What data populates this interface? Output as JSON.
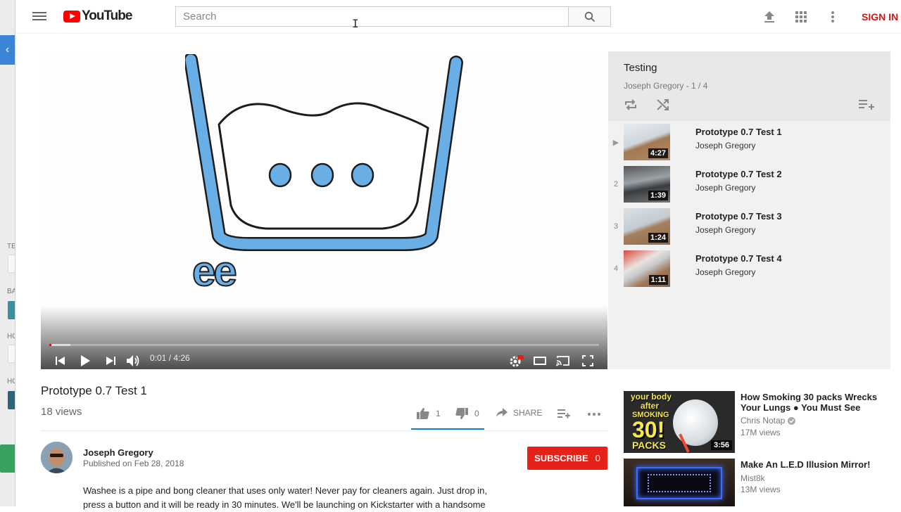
{
  "header": {
    "logo_text": "YouTube",
    "search_placeholder": "Search",
    "signin_label": "SIGN IN"
  },
  "player": {
    "time": "0:01 / 4:26",
    "progress_fraction": 0.004,
    "overlay_text": "ee"
  },
  "playlist": {
    "title": "Testing",
    "subtitle": "Joseph Gregory - 1 / 4",
    "items": [
      {
        "index": "▶",
        "title": "Prototype 0.7 Test 1",
        "channel": "Joseph Gregory",
        "duration": "4:27"
      },
      {
        "index": "2",
        "title": "Prototype 0.7 Test 2",
        "channel": "Joseph Gregory",
        "duration": "1:39"
      },
      {
        "index": "3",
        "title": "Prototype 0.7 Test 3",
        "channel": "Joseph Gregory",
        "duration": "1:24"
      },
      {
        "index": "4",
        "title": "Prototype 0.7 Test 4",
        "channel": "Joseph Gregory",
        "duration": "1:11"
      }
    ]
  },
  "video": {
    "title": "Prototype 0.7 Test 1",
    "views": "18 views",
    "likes": "1",
    "dislikes": "0",
    "share_label": "SHARE",
    "channel": "Joseph Gregory",
    "published": "Published on Feb 28, 2018",
    "subscribe_label": "SUBSCRIBE",
    "subscriber_count": "0",
    "description": "Washee is a pipe and bong cleaner that uses only water! Never pay for cleaners again. Just drop in, press a button and it will be ready in 30 minutes. We'll be launching on Kickstarter with a handsome"
  },
  "related": [
    {
      "title": "How Smoking 30 packs Wrecks Your Lungs ● You Must See",
      "channel": "Chris Notap",
      "views": "17M views",
      "duration": "3:56",
      "thumb_line1": "your body",
      "thumb_line2": "after",
      "thumb_line3": "SMOKING",
      "thumb_line4": "30!",
      "thumb_line5": "PACKS"
    },
    {
      "title": "Make An L.E.D Illusion Mirror!",
      "channel": "Mist8k",
      "views": "13M views"
    }
  ],
  "left_strip": {
    "labels": [
      "TE",
      "BA",
      "HO",
      "HO"
    ]
  },
  "colors": {
    "brand_red": "#ff0000",
    "signin_red": "#cc181e",
    "subscribe_red": "#e62117",
    "accent_blue": "#167ac6",
    "washee_blue": "#6aaee6"
  }
}
